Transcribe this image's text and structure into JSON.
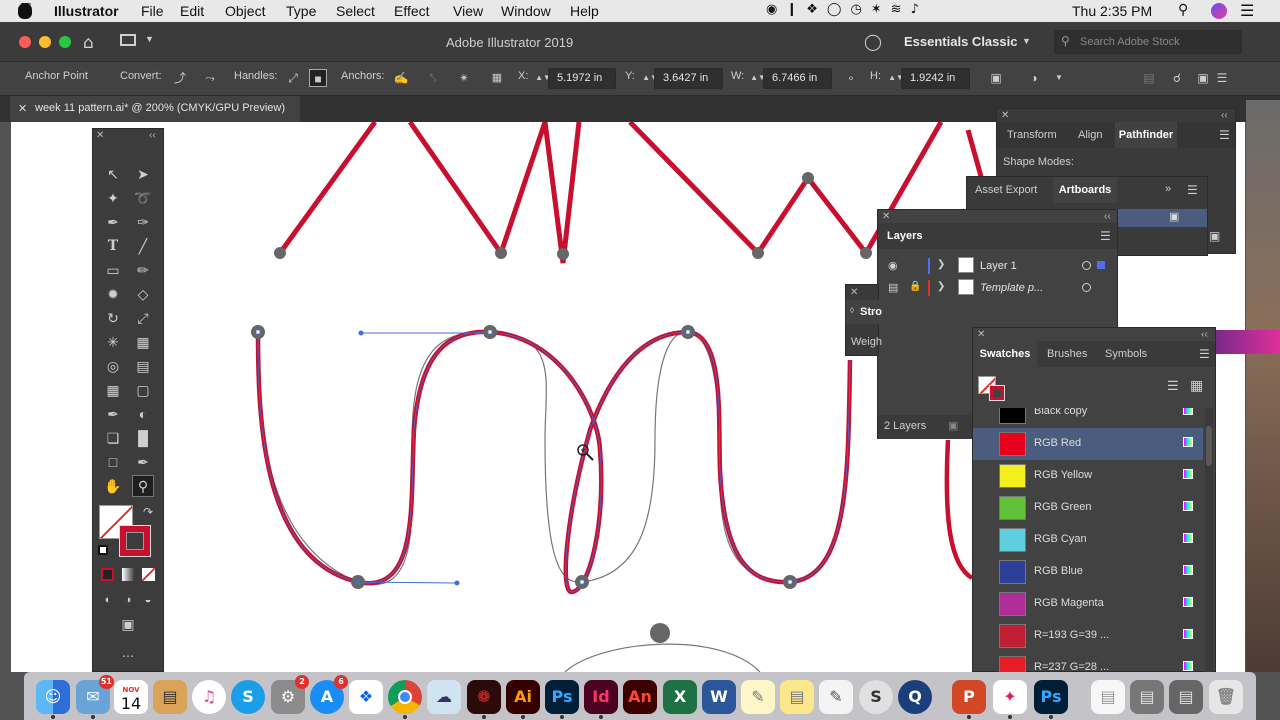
{
  "menubar": {
    "app": "Illustrator",
    "items": [
      "File",
      "Edit",
      "Object",
      "Type",
      "Select",
      "Effect",
      "View",
      "Window",
      "Help"
    ],
    "clock": "Thu 2:35 PM"
  },
  "appbar": {
    "title": "Adobe Illustrator 2019",
    "workspace": "Essentials Classic",
    "search_placeholder": "Search Adobe Stock"
  },
  "controlbar": {
    "anchor_point": "Anchor Point",
    "convert": "Convert:",
    "handles": "Handles:",
    "anchors": "Anchors:",
    "x_label": "X:",
    "x_value": "5.1972 in",
    "y_label": "Y:",
    "y_value": "3.6427 in",
    "w_label": "W:",
    "w_value": "6.7466 in",
    "h_label": "H:",
    "h_value": "1.9242 in"
  },
  "document": {
    "tab": "week 11 pattern.ai* @ 200% (CMYK/GPU Preview)"
  },
  "panels": {
    "transform_group": {
      "tabs": [
        "Transform",
        "Align",
        "Pathfinder"
      ],
      "section": "Shape Modes:"
    },
    "artboards_group": {
      "tabs": [
        "Asset Export",
        "Artboards"
      ]
    },
    "layers": {
      "title": "Layers",
      "rows": [
        {
          "name": "Layer 1",
          "color": "#4f6ff0"
        },
        {
          "name": "Template p...",
          "color": "#e0302c"
        }
      ],
      "footer": "2 Layers"
    },
    "stroke": {
      "title": "Stro",
      "weight": "Weigh"
    },
    "swatches": {
      "tabs": [
        "Swatches",
        "Brushes",
        "Symbols"
      ],
      "items": [
        {
          "name": "Black copy",
          "color": "#000000"
        },
        {
          "name": "RGB Red",
          "color": "#e8001c"
        },
        {
          "name": "RGB Yellow",
          "color": "#f4f01e"
        },
        {
          "name": "RGB Green",
          "color": "#5fc238"
        },
        {
          "name": "RGB Cyan",
          "color": "#5fcfe0"
        },
        {
          "name": "RGB Blue",
          "color": "#2e3f9a"
        },
        {
          "name": "RGB Magenta",
          "color": "#b02e9a"
        },
        {
          "name": "R=193 G=39 ...",
          "color": "#c11f33"
        },
        {
          "name": "R=237 G=28 ...",
          "color": "#e81c24"
        }
      ]
    }
  },
  "dock": {
    "mail_badge": "51",
    "calendar_month": "NOV",
    "calendar_day": "14",
    "settings_badge": "2",
    "appstore_badge": "6",
    "ai": "Ai",
    "ps": "Ps",
    "id": "Id",
    "an": "An",
    "ps2": "Ps"
  },
  "colors": {
    "stroke_red": "#c8102e",
    "ui_dark": "#424242",
    "selection_blue": "#3f6fd8"
  }
}
